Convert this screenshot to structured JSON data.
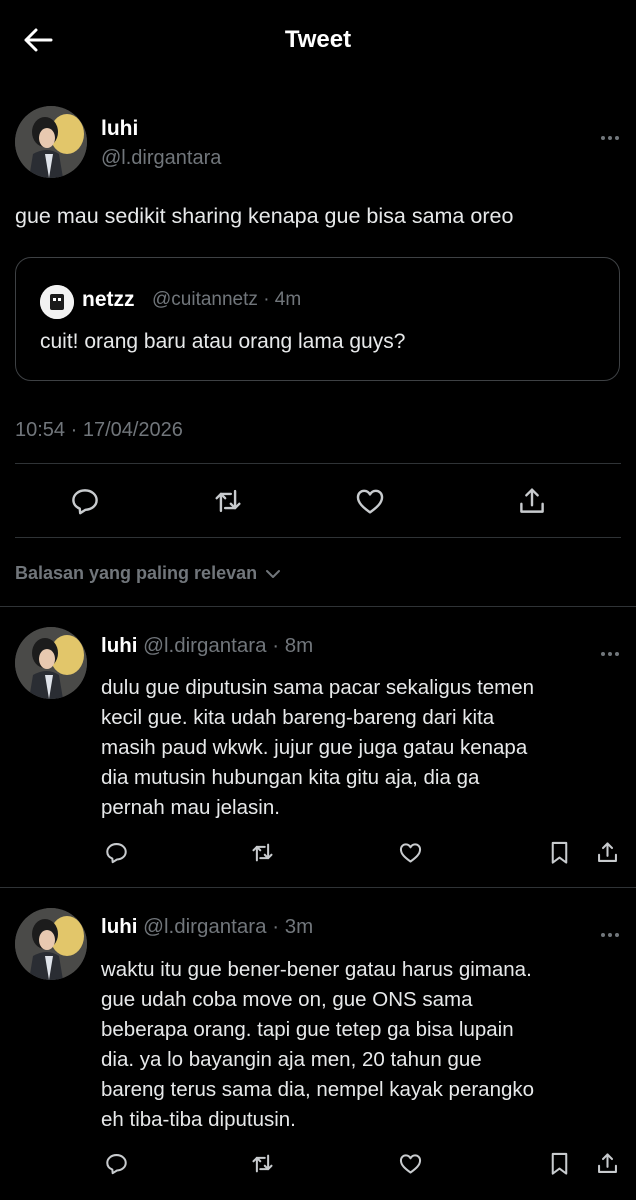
{
  "header": {
    "title": "Tweet"
  },
  "main_tweet": {
    "name": "luhi",
    "handle": "@l.dirgantara",
    "text": "gue mau sedikit sharing kenapa gue bisa sama oreo",
    "quote": {
      "name": "netzz",
      "handle": "@cuitannetz",
      "time": "· 4m",
      "text": "cuit! orang baru atau orang lama guys?"
    },
    "timestamp": "10:54 · 17/04/2026"
  },
  "sort_label": "Balasan yang paling relevan",
  "replies": [
    {
      "name": "luhi",
      "handle": "@l.dirgantara",
      "time": "· 8m",
      "lines": [
        "dulu gue diputusin sama pacar sekaligus temen",
        "kecil gue. kita udah bareng-bareng dari kita",
        "masih paud wkwk. jujur gue juga gatau kenapa",
        "dia mutusin hubungan kita gitu aja, dia ga",
        "pernah mau jelasin."
      ]
    },
    {
      "name": "luhi",
      "handle": "@l.dirgantara",
      "time": "· 3m",
      "lines": [
        "waktu itu gue bener-bener gatau harus gimana.",
        "gue udah coba move on, gue ONS sama",
        "beberapa orang. tapi gue tetep ga bisa lupain",
        "dia. ya lo bayangin aja men, 20 tahun gue",
        "bareng terus sama dia, nempel kayak perangko",
        "eh tiba-tiba diputusin."
      ]
    }
  ],
  "colors": {
    "background": "#000000",
    "text": "#e7e9ea",
    "muted": "#71767b",
    "divider": "#2f3336"
  },
  "icons": [
    "back-arrow-icon",
    "more-icon",
    "reply-icon",
    "retweet-icon",
    "like-icon",
    "share-icon",
    "bookmark-icon",
    "chevron-down-icon"
  ]
}
